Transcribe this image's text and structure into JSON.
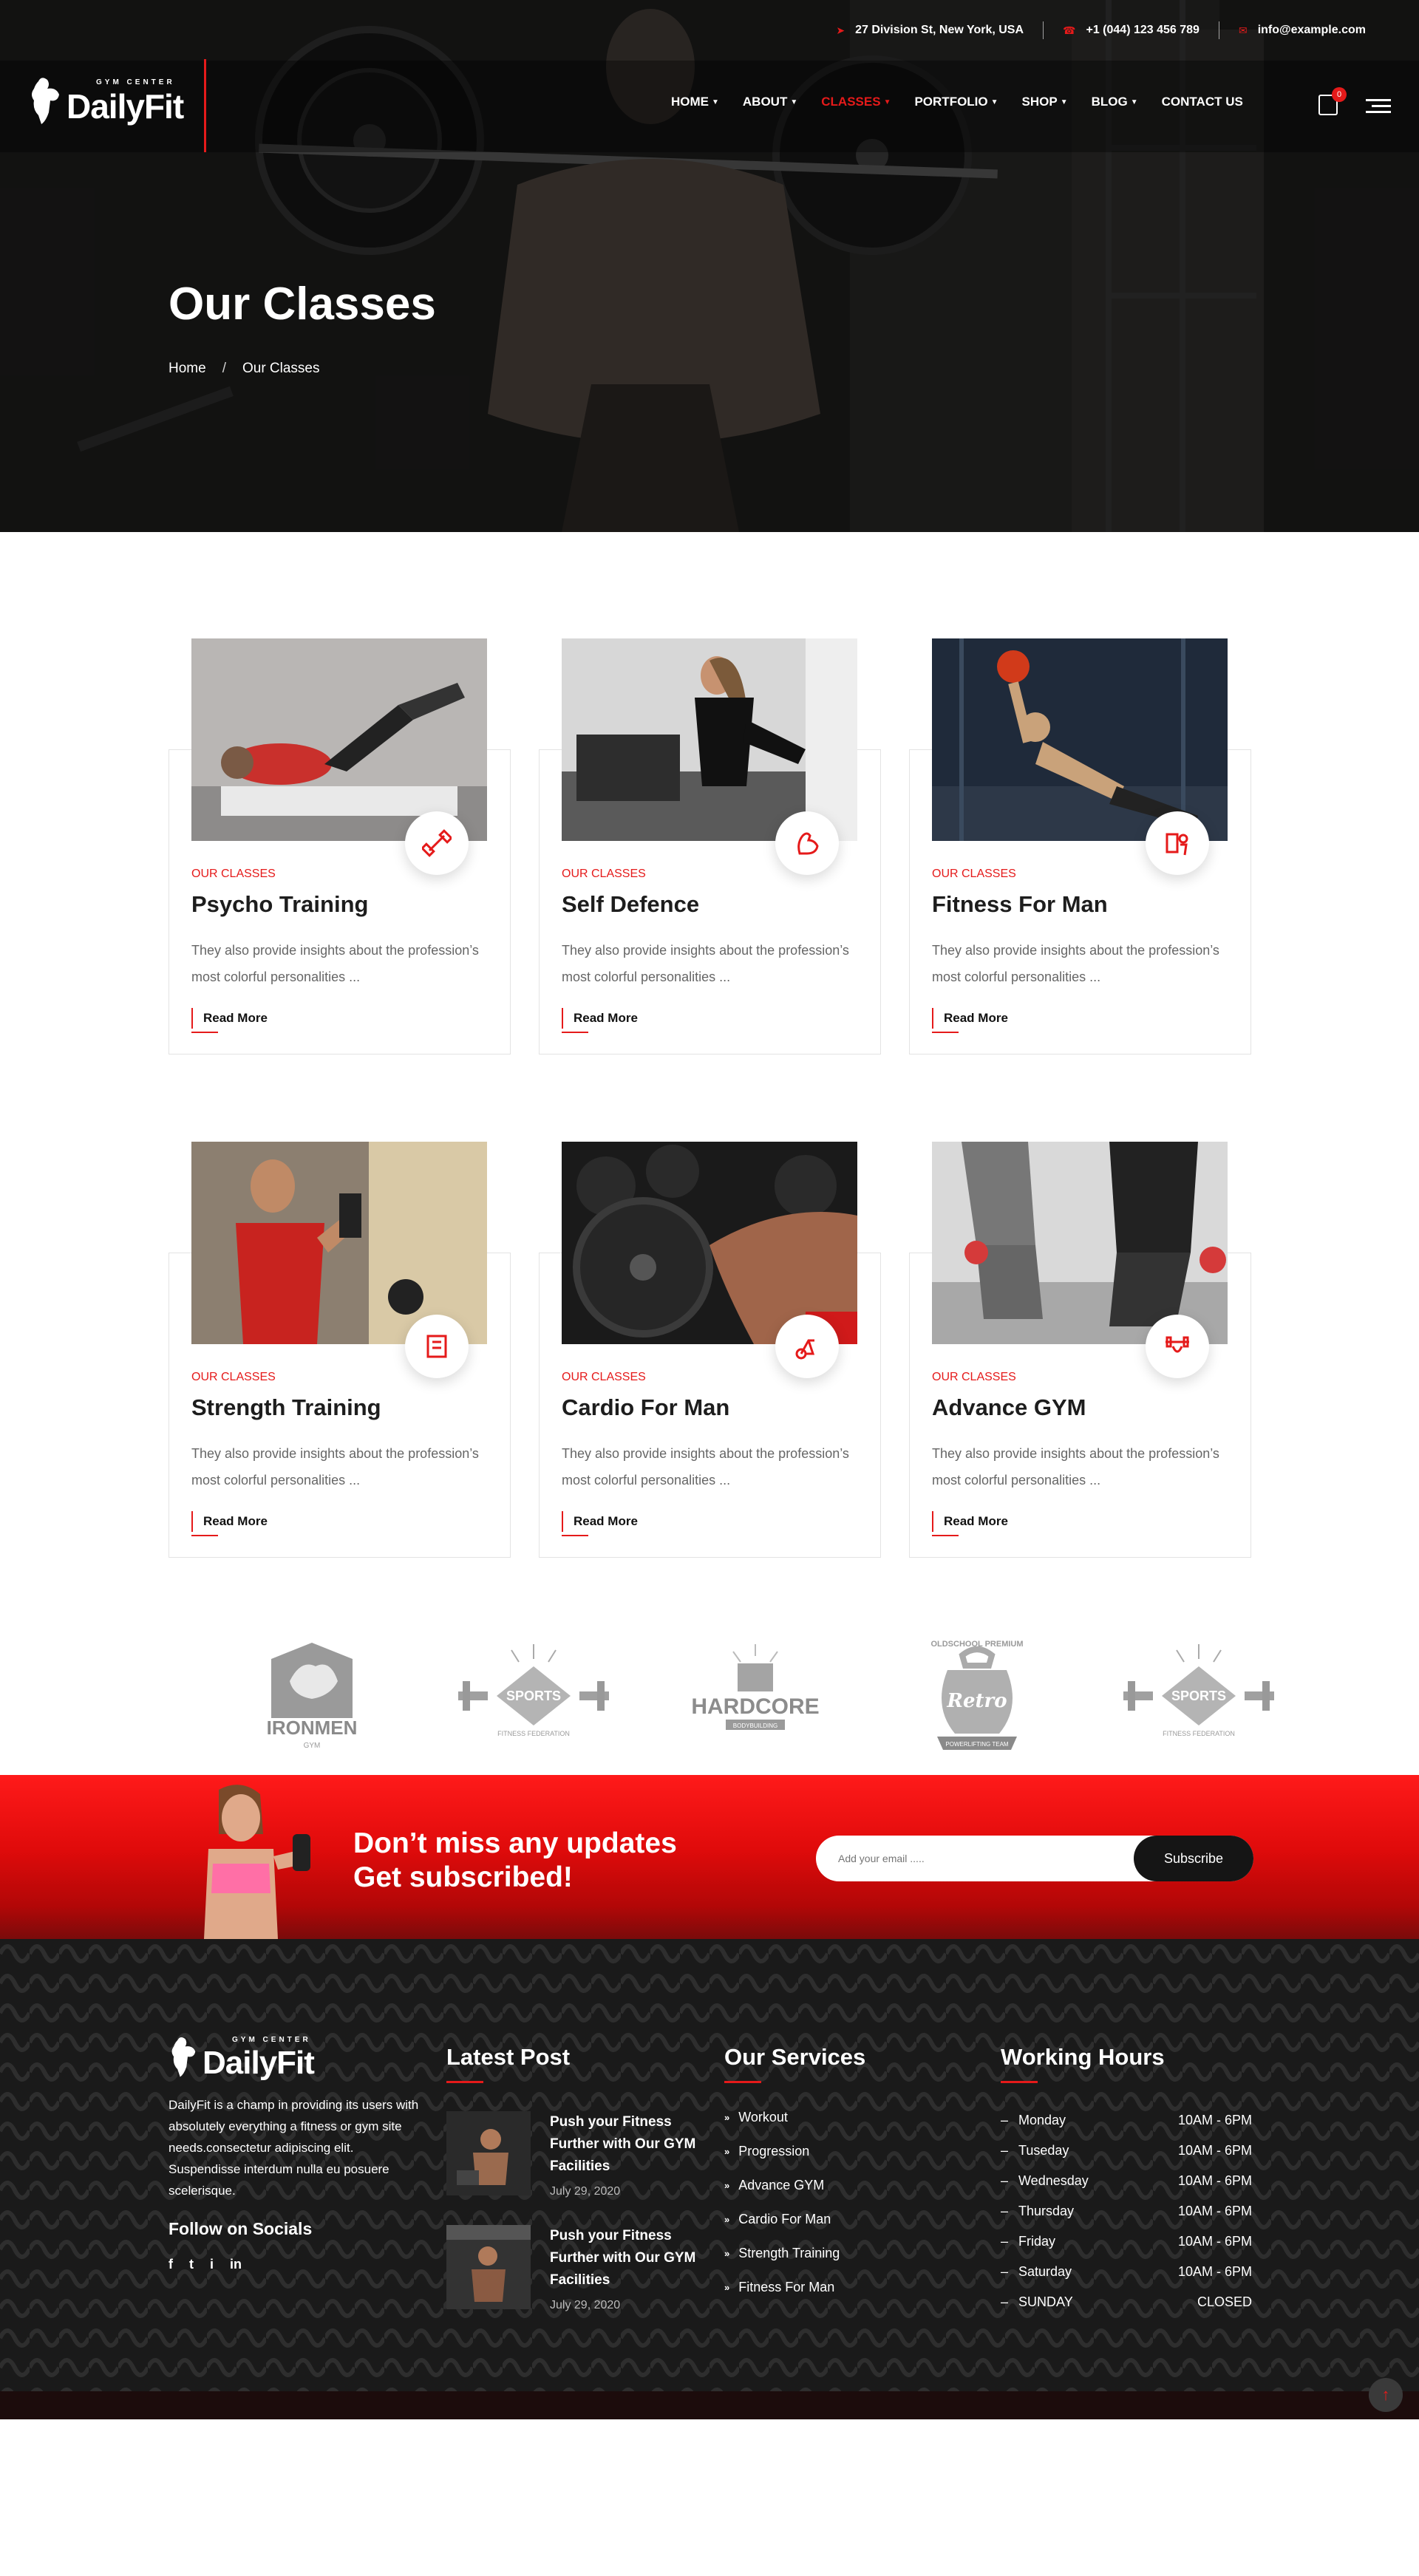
{
  "topbar": {
    "address": "27 Division St, New York, USA",
    "phone": "+1 (044) 123 456 789",
    "email": "info@example.com"
  },
  "logo": {
    "subtitle": "GYM CENTER",
    "brand": "DailyFit"
  },
  "menu": [
    {
      "label": "HOME",
      "dropdown": true
    },
    {
      "label": "ABOUT",
      "dropdown": true
    },
    {
      "label": "CLASSES",
      "dropdown": true,
      "active": true
    },
    {
      "label": "PORTFOLIO",
      "dropdown": true
    },
    {
      "label": "SHOP",
      "dropdown": true
    },
    {
      "label": "BLOG",
      "dropdown": true
    },
    {
      "label": "CONTACT US",
      "dropdown": false
    }
  ],
  "cart": {
    "count": "0"
  },
  "hero": {
    "title": "Our Classes",
    "breadcrumb_home": "Home",
    "breadcrumb_sep": "/",
    "breadcrumb_current": "Our Classes"
  },
  "classes": [
    {
      "category": "OUR CLASSES",
      "title": "Psycho Training",
      "desc": "They also provide insights about the profession’s most colorful personalities ...",
      "read_more": "Read More",
      "icon": "dumbbell-icon"
    },
    {
      "category": "OUR CLASSES",
      "title": "Self Defence",
      "desc": "They also provide insights about the profession’s most colorful personalities ...",
      "read_more": "Read More",
      "icon": "muscle-arm-icon"
    },
    {
      "category": "OUR CLASSES",
      "title": "Fitness For Man",
      "desc": "They also provide insights about the profession’s most colorful personalities ...",
      "read_more": "Read More",
      "icon": "gym-person-icon"
    },
    {
      "category": "OUR CLASSES",
      "title": "Strength Training",
      "desc": "They also provide insights about the profession’s most colorful personalities ...",
      "read_more": "Read More",
      "icon": "weight-machine-icon"
    },
    {
      "category": "OUR CLASSES",
      "title": "Cardio For Man",
      "desc": "They also provide insights about the profession’s most colorful personalities ...",
      "read_more": "Read More",
      "icon": "exercise-bike-icon"
    },
    {
      "category": "OUR CLASSES",
      "title": "Advance GYM",
      "desc": "They also provide insights about the profession’s most colorful personalities ...",
      "read_more": "Read More",
      "icon": "barbell-hand-icon"
    }
  ],
  "brands": [
    {
      "name": "IRONMEN",
      "sub": "GYM"
    },
    {
      "name": "SPORTS",
      "sub": "FITNESS FEDERATION"
    },
    {
      "name": "HARDCORE",
      "sub": "BODYBUILDING"
    },
    {
      "name": "Retro",
      "sub": "POWERLIFTING TEAM",
      "top": "OLDSCHOOL PREMIUM"
    },
    {
      "name": "SPORTS",
      "sub": "FITNESS FEDERATION"
    }
  ],
  "subscribe": {
    "line1": "Don’t miss any updates",
    "line2": "Get subscribed!",
    "placeholder": "Add your email .....",
    "button": "Subscribe"
  },
  "footer": {
    "about": "DailyFit is a champ in providing its users with absolutely everything a fitness or gym site needs.consectetur adipiscing elit. Suspendisse interdum nulla eu posuere scelerisque.",
    "follow": "Follow on Socials",
    "socials": [
      "f",
      "t",
      "i",
      "in"
    ],
    "latest_post_heading": "Latest Post",
    "posts": [
      {
        "title": "Push your Fitness Further with Our GYM Facilities",
        "date": "July 29, 2020"
      },
      {
        "title": "Push your Fitness Further with Our GYM Facilities",
        "date": "July 29, 2020"
      }
    ],
    "services_heading": "Our Services",
    "services": [
      "Workout",
      "Progression",
      "Advance GYM",
      "Cardio For Man",
      "Strength Training",
      "Fitness For Man"
    ],
    "hours_heading": "Working Hours",
    "hours": [
      {
        "day": "Monday",
        "time": "10AM - 6PM"
      },
      {
        "day": "Tuseday",
        "time": "10AM - 6PM"
      },
      {
        "day": "Wednesday",
        "time": "10AM - 6PM"
      },
      {
        "day": "Thursday",
        "time": "10AM - 6PM"
      },
      {
        "day": "Friday",
        "time": "10AM - 6PM"
      },
      {
        "day": "Saturday",
        "time": "10AM - 6PM"
      },
      {
        "day": "SUNDAY",
        "time": "CLOSED"
      }
    ]
  },
  "colors": {
    "accent": "#e51a1a",
    "dark": "#151515",
    "text": "#666666"
  }
}
